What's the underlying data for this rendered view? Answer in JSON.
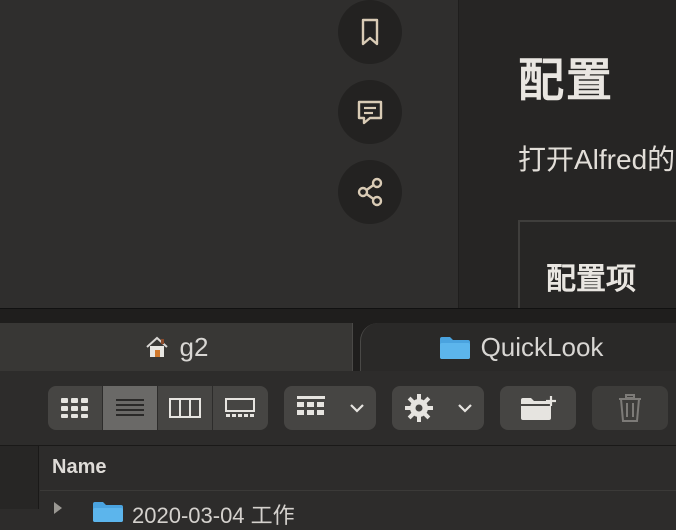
{
  "article": {
    "heading": "配置",
    "paragraph": "打开Alfred的",
    "table_header": "配置项"
  },
  "actions": {
    "bookmark_icon": "bookmark-icon",
    "comment_icon": "comment-icon",
    "share_icon": "share-icon"
  },
  "finder": {
    "tabs": [
      {
        "label": "g2",
        "icon": "home-icon"
      },
      {
        "label": "QuickLook",
        "icon": "folder-icon"
      }
    ],
    "toolbar": {
      "views": [
        "icon-view",
        "list-view",
        "column-view",
        "gallery-view"
      ],
      "active_view": "list-view"
    },
    "columns": {
      "name": "Name"
    },
    "rows": [
      {
        "label": "2020-03-04 工作"
      }
    ]
  },
  "colors": {
    "folder_blue": "#4aa3df",
    "accent_text": "#e9e6e1"
  }
}
